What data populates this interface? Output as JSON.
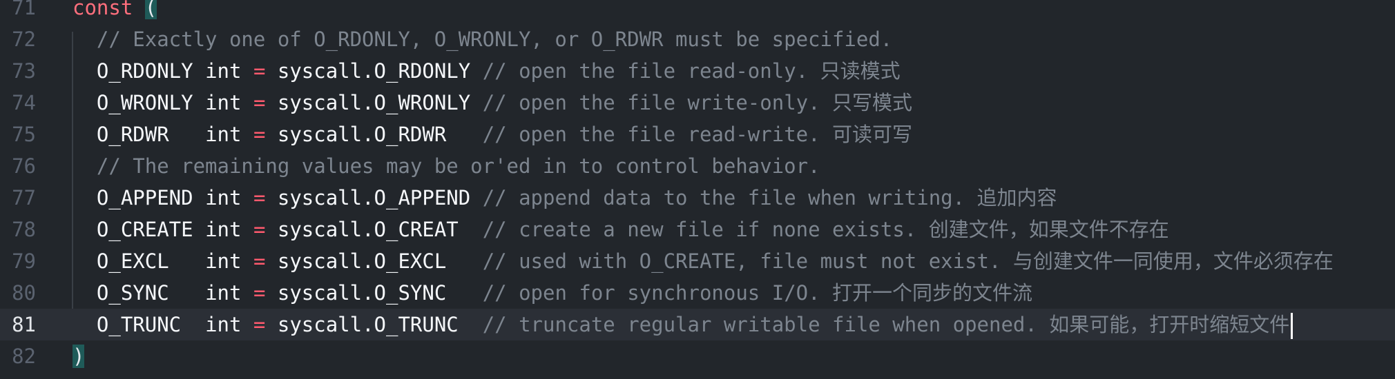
{
  "editor": {
    "lines": [
      {
        "number": "71",
        "text": "const ("
      },
      {
        "number": "72",
        "text": "  // Exactly one of O_RDONLY, O_WRONLY, or O_RDWR must be specified."
      },
      {
        "number": "73",
        "text": "  O_RDONLY int = syscall.O_RDONLY // open the file read-only. 只读模式"
      },
      {
        "number": "74",
        "text": "  O_WRONLY int = syscall.O_WRONLY // open the file write-only. 只写模式"
      },
      {
        "number": "75",
        "text": "  O_RDWR   int = syscall.O_RDWR   // open the file read-write. 可读可写"
      },
      {
        "number": "76",
        "text": "  // The remaining values may be or'ed in to control behavior."
      },
      {
        "number": "77",
        "text": "  O_APPEND int = syscall.O_APPEND // append data to the file when writing. 追加内容"
      },
      {
        "number": "78",
        "text": "  O_CREATE int = syscall.O_CREAT  // create a new file if none exists. 创建文件，如果文件不存在"
      },
      {
        "number": "79",
        "text": "  O_EXCL   int = syscall.O_EXCL   // used with O_CREATE, file must not exist. 与创建文件一同使用，文件必须存在"
      },
      {
        "number": "80",
        "text": "  O_SYNC   int = syscall.O_SYNC   // open for synchronous I/O. 打开一个同步的文件流"
      },
      {
        "number": "81",
        "text": "  O_TRUNC  int = syscall.O_TRUNC  // truncate regular writable file when opened. 如果可能，打开时缩短文件"
      },
      {
        "number": "82",
        "text": ")"
      }
    ],
    "current_line": "81",
    "colors": {
      "background": "#22262b",
      "keyword": "#ff6f7d",
      "operator": "#ff5a6e",
      "comment": "#7d858f",
      "identifier": "#f5f7fa",
      "bracket_match": "#1f5b59"
    }
  }
}
